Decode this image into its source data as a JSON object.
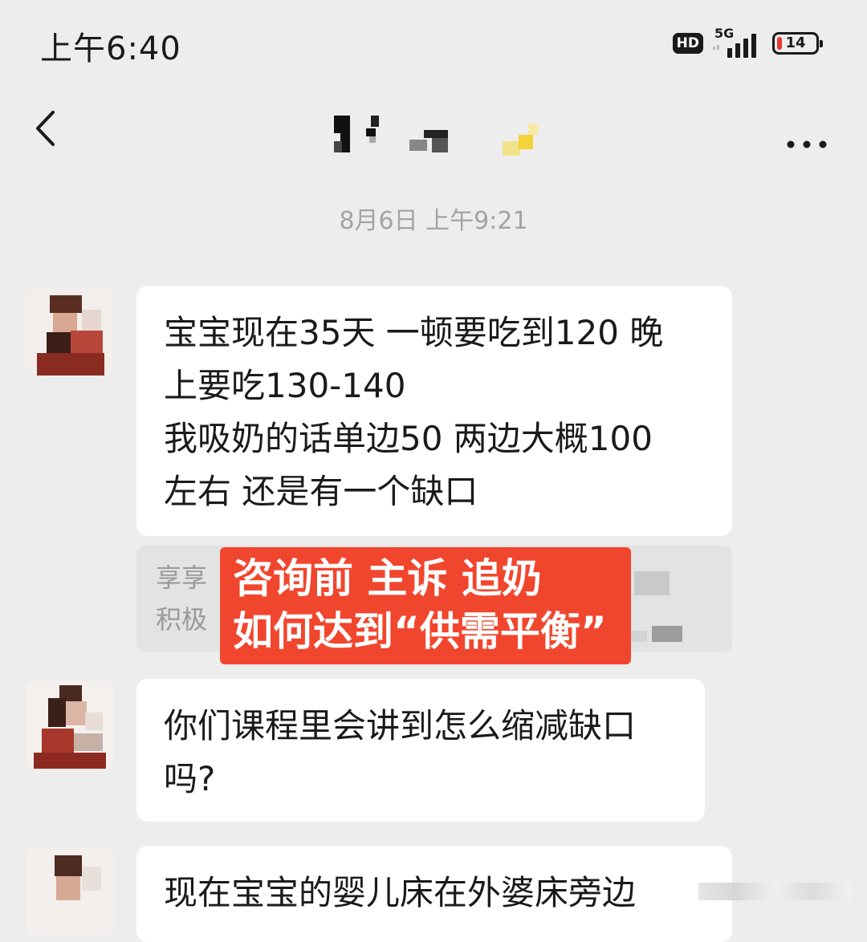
{
  "status_bar": {
    "time": "上午6:40",
    "hd_label": "HD",
    "network_type": "5G",
    "battery_level": "14",
    "battery_fraction": 0.14,
    "battery_color": "#e23a2e"
  },
  "nav": {
    "back_icon": "chevron-left-icon",
    "more_icon": "more-dots-icon"
  },
  "chat": {
    "timestamp": "8月6日 上午9:21",
    "messages": [
      {
        "lines": [
          "宝宝现在35天 一顿要吃到120 晚",
          "上要吃130-140",
          "我吸奶的话单边50 两边大概100",
          "左右 还是有一个缺口"
        ]
      },
      {
        "lines": [
          "你们课程里会讲到怎么缩减缺口",
          "吗?"
        ]
      },
      {
        "lines": [
          "现在宝宝的婴儿床在外婆床旁边"
        ]
      }
    ],
    "quote_card": {
      "lines": [
        "享享",
        "积极"
      ]
    },
    "overlay_banner": {
      "lines": [
        "咨询前 主诉 追奶",
        "如何达到“供需平衡”"
      ],
      "color": "#f1462e"
    }
  }
}
